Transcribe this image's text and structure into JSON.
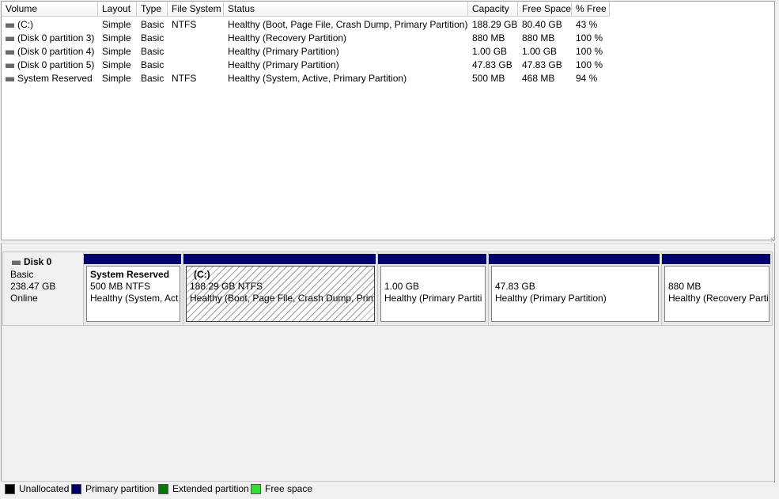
{
  "volume_list": {
    "columns": [
      "Volume",
      "Layout",
      "Type",
      "File System",
      "Status",
      "Capacity",
      "Free Space",
      "% Free"
    ],
    "rows": [
      {
        "volume": "(C:)",
        "layout": "Simple",
        "type": "Basic",
        "fs": "NTFS",
        "status": "Healthy (Boot, Page File, Crash Dump, Primary Partition)",
        "capacity": "188.29 GB",
        "free": "80.40 GB",
        "pct": "43 %"
      },
      {
        "volume": "(Disk 0 partition 3)",
        "layout": "Simple",
        "type": "Basic",
        "fs": "",
        "status": "Healthy (Recovery Partition)",
        "capacity": "880 MB",
        "free": "880 MB",
        "pct": "100 %"
      },
      {
        "volume": "(Disk 0 partition 4)",
        "layout": "Simple",
        "type": "Basic",
        "fs": "",
        "status": "Healthy (Primary Partition)",
        "capacity": "1.00 GB",
        "free": "1.00 GB",
        "pct": "100 %"
      },
      {
        "volume": "(Disk 0 partition 5)",
        "layout": "Simple",
        "type": "Basic",
        "fs": "",
        "status": "Healthy (Primary Partition)",
        "capacity": "47.83 GB",
        "free": "47.83 GB",
        "pct": "100 %"
      },
      {
        "volume": "System Reserved",
        "layout": "Simple",
        "type": "Basic",
        "fs": "NTFS",
        "status": "Healthy (System, Active, Primary Partition)",
        "capacity": "500 MB",
        "free": "468 MB",
        "pct": "94 %"
      }
    ]
  },
  "disk": {
    "name": "Disk 0",
    "type": "Basic",
    "size": "238.47 GB",
    "state": "Online",
    "icon": "disk-icon",
    "partitions": [
      {
        "title": "System Reserved",
        "size_line": "500 MB NTFS",
        "status_line": "Healthy (System, Act",
        "selected": false
      },
      {
        "title": "(C:)",
        "size_line": "188.29 GB NTFS",
        "status_line": "Healthy (Boot, Page File, Crash Dump, Prim",
        "selected": true
      },
      {
        "title": "",
        "size_line": "1.00 GB",
        "status_line": "Healthy (Primary Partiti",
        "selected": false
      },
      {
        "title": "",
        "size_line": "47.83 GB",
        "status_line": "Healthy (Primary Partition)",
        "selected": false
      },
      {
        "title": "",
        "size_line": "880 MB",
        "status_line": "Healthy (Recovery Parti",
        "selected": false
      }
    ]
  },
  "legend": [
    {
      "label": "Unallocated",
      "color": "#000000"
    },
    {
      "label": "Primary partition",
      "color": "#00006b"
    },
    {
      "label": "Extended partition",
      "color": "#007a00"
    },
    {
      "label": "Free space",
      "color": "#33dd33"
    }
  ],
  "colors": {
    "primary_partition": "#00006b",
    "background": "#f0f0f0"
  }
}
